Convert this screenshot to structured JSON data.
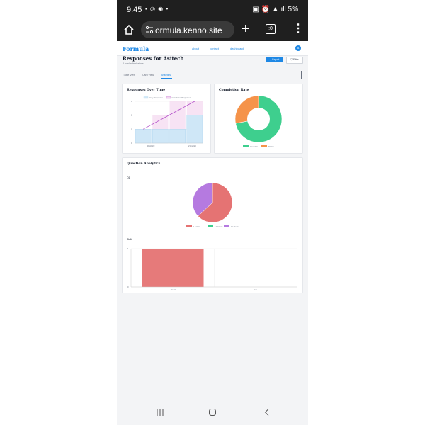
{
  "status": {
    "time": "9:45",
    "right": "5%"
  },
  "browser": {
    "url": "ormula.kenno.site",
    "tabs_count": ":0"
  },
  "nav": {
    "logo": "Formula",
    "links": [
      "about",
      "contact",
      "dashboard"
    ],
    "avatar": "A"
  },
  "header": {
    "title": "Responses for Asitech",
    "subtitle": "2 total submissions",
    "export_label": "Export",
    "filter_label": "Filter"
  },
  "tabs": [
    "Table View",
    "Card View",
    "Analytics"
  ],
  "responses_over_time": {
    "title": "Responses Over Time",
    "legend": [
      "Daily Responses",
      "Cumulative Responses"
    ],
    "dates": [
      "9/11/2023",
      "9/15/2023"
    ],
    "y_ticks": [
      "0",
      "1",
      "2",
      "3"
    ]
  },
  "completion_rate": {
    "title": "Completion Rate",
    "legend": [
      "Complete",
      "Partial"
    ]
  },
  "question_analytics": {
    "title": "Question Analytics",
    "q1": {
      "label": "Q1",
      "legend": [
        "1-5 Years",
        "5-10 Years",
        "10+ Years"
      ]
    },
    "q2": {
      "label": "Skills",
      "bar_labels": [
        "React",
        "Vue"
      ],
      "y_ticks": [
        "0",
        "1"
      ]
    }
  },
  "colors": {
    "accent": "#1e88e5",
    "green": "#3ecf8e",
    "orange": "#f5934a",
    "red": "#e57373",
    "purple": "#b57ae0"
  },
  "chart_data": [
    {
      "type": "bar",
      "title": "Responses Over Time",
      "categories": [
        "9/11/2023",
        "",
        "",
        "9/15/2023"
      ],
      "series": [
        {
          "name": "Daily Responses",
          "values": [
            1,
            1,
            1,
            2
          ]
        },
        {
          "name": "Cumulative Responses",
          "values": [
            1,
            2,
            3,
            5
          ]
        }
      ],
      "ylim": [
        0,
        3
      ],
      "grid": true,
      "legend": "top"
    },
    {
      "type": "pie",
      "title": "Completion Rate",
      "categories": [
        "Complete",
        "Partial"
      ],
      "values": [
        72,
        28
      ],
      "legend": "bottom"
    },
    {
      "type": "pie",
      "title": "Q1",
      "categories": [
        "1-5 Years",
        "5-10 Years",
        "10+ Years"
      ],
      "values": [
        63,
        0,
        37
      ],
      "legend": "bottom"
    },
    {
      "type": "bar",
      "title": "Skills",
      "categories": [
        "React",
        "Vue"
      ],
      "values": [
        1,
        0
      ],
      "ylim": [
        0,
        1
      ],
      "grid": true
    }
  ]
}
